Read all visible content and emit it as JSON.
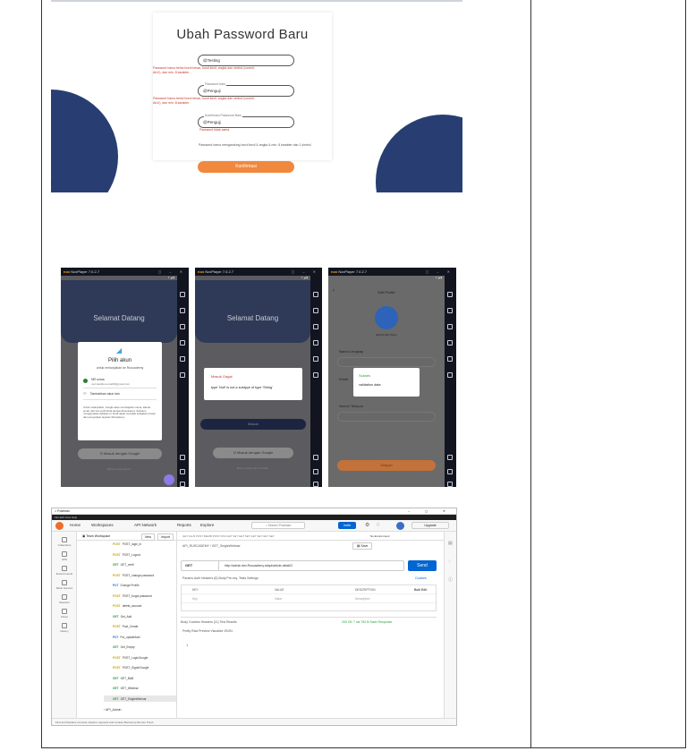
{
  "panel_change_password": {
    "title": "Ubah Password Baru",
    "fields": [
      {
        "label": "",
        "value": "@Testing"
      },
      {
        "label": "Password baru",
        "value": "@Penguji"
      },
      {
        "label": "Konfirmasi Password Baru",
        "value": "@Pengujj"
      }
    ],
    "errors": [
      "Password harus berisi huruf besar, huruf kecil, angka dan simbol (contoh: Ab1!), dan min. 8 karakter",
      "Password harus berisi huruf besar, huruf kecil, angka dan simbol (contoh: Ab1!), dan min. 8 karakter",
      "Password tidak sama"
    ],
    "hint": "Password harus mengandung huruf kecil & angka & min. 8 karakter dan 1 simbol",
    "confirm_button": "Konfirmasi",
    "page_number": "3"
  },
  "nox_windows": [
    {
      "app_title": "NoxPlayer 7.0.2.7",
      "header": "Selamat Datang",
      "dialog_title": "Pilih akun",
      "dialog_subtitle": "untuk melanjutkan ke Ruscademy",
      "account_name": "NR suma",
      "account_email": "nurmaulida.suma03@gmail.com",
      "add_account": "Tambahkan akun lain",
      "dialog_footer": "Untuk melanjutkan, Google akan membagikan nama, alamat email, dan foto profil Anda dengan Ruscademy. Sebelum menggunakan aplikasi ini, Anda dapat meninjau kebijakan privasi dan persyaratan layanan Ruscademy.",
      "google_button": "Masuk dengan Google",
      "footer_link": "Belum punya akun?"
    },
    {
      "app_title": "NoxPlayer 7.0.2.7",
      "header": "Selamat Datang",
      "dialog_title": "Masuk Gagal",
      "dialog_message": "type 'Null' is not a subtype of type 'String'",
      "main_button": "Masuk",
      "google_button": "Masuk dengan Google",
      "footer_link": "Belum punya akun? Daftar"
    },
    {
      "app_title": "NoxPlayer 7.0.2.7",
      "header": "Edit Profile",
      "avatar_caption": "Edit Profile Photo",
      "label_name": "Nama Lengkap",
      "label_email": "Email",
      "label_phone": "Nomor Telepon",
      "dialog_title": "Sukses",
      "dialog_message": "validation data",
      "save_button": "Simpan"
    }
  ],
  "postman": {
    "window_title": "Postman",
    "menu": "File  Edit  View  Help",
    "nav": [
      "Home",
      "Workspaces",
      "API Network",
      "Reports",
      "Explore"
    ],
    "search": "Search Postman",
    "invite": "Invite",
    "upgrade": "Upgrade",
    "workspace": "Team Workspace",
    "new_btn": "New",
    "import_btn": "Import",
    "rail": [
      "Collections",
      "APIs",
      "Environments",
      "Mock Servers",
      "Monitors",
      "Flows",
      "History"
    ],
    "tree": [
      {
        "m": "POST",
        "name": "POST_login_in"
      },
      {
        "m": "POST",
        "name": "POST_Logout"
      },
      {
        "m": "GET",
        "name": "GET_verifi"
      },
      {
        "m": "POST",
        "name": "POST_change password"
      },
      {
        "m": "PUT",
        "name": "Change Profile"
      },
      {
        "m": "POST",
        "name": "POST_forgot password"
      },
      {
        "m": "POST",
        "name": "delete_account"
      },
      {
        "m": "GET",
        "name": "Get_Add"
      },
      {
        "m": "POST",
        "name": "Post_Create"
      },
      {
        "m": "PUT",
        "name": "Put_updateAdd"
      },
      {
        "m": "GET",
        "name": "Get_Empty"
      },
      {
        "m": "POST",
        "name": "POST_LoginGoogle"
      },
      {
        "m": "POST",
        "name": "POST_SignInGoogle"
      },
      {
        "m": "GET",
        "name": "GET_BAB"
      },
      {
        "m": "GET",
        "name": "GET_Webinar"
      },
      {
        "m": "GET",
        "name": "GET_SingleWebinar"
      }
    ],
    "tree_footer": "API_Admin",
    "tabs": "GET ALLB  POST MEMB  POST PAS  GET SET  GET SET  GET SET  GET SET",
    "env": "No Environment",
    "breadcrumb": "API_RUSCADEMY / GET_SingleWebinar",
    "method": "GET",
    "url": "http://admin.dev.Ruscademy.id/api/article-detail/2",
    "send": "Send",
    "save": "Save",
    "params_tabs": "Params  Auth  Headers (8)  Body  Pre-req.  Tests  Settings",
    "cookies": "Cookies",
    "grid_headers": [
      "KEY",
      "VALUE",
      "DESCRIPTION",
      "Bulk Edit"
    ],
    "grid_placeholders": [
      "Key",
      "Value",
      "Description"
    ],
    "response_tabs": "Body  Cookies  Headers (11)  Test Results",
    "response_status": "200 OK   7 ms   752 B   Save Response",
    "body_controls": "Pretty   Raw   Preview   Visualize   JSON",
    "line": "1",
    "footer": "Find and Replace   Console          Capture requests and cookies   Bootcamp   Runner   Trash"
  }
}
